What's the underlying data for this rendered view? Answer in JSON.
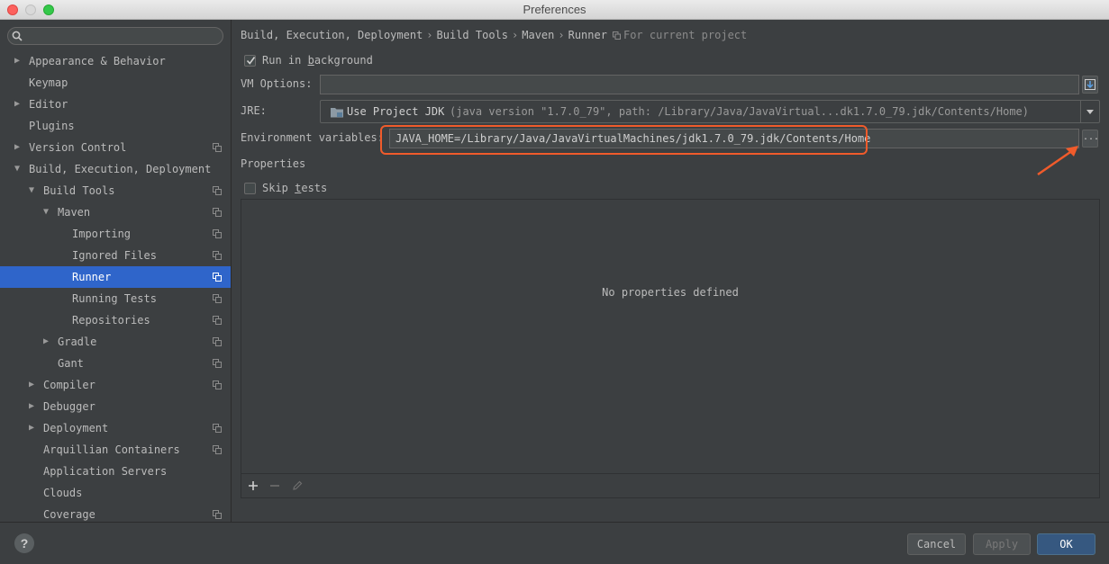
{
  "window": {
    "title": "Preferences"
  },
  "search": {
    "placeholder": ""
  },
  "sidebar": {
    "items": [
      {
        "label": "Appearance & Behavior",
        "indent": 0,
        "arrow": "collapsed",
        "project_icon": false
      },
      {
        "label": "Keymap",
        "indent": 0,
        "arrow": "none",
        "project_icon": false
      },
      {
        "label": "Editor",
        "indent": 0,
        "arrow": "collapsed",
        "project_icon": false
      },
      {
        "label": "Plugins",
        "indent": 0,
        "arrow": "none",
        "project_icon": false
      },
      {
        "label": "Version Control",
        "indent": 0,
        "arrow": "collapsed",
        "project_icon": true
      },
      {
        "label": "Build, Execution, Deployment",
        "indent": 0,
        "arrow": "expanded",
        "project_icon": false
      },
      {
        "label": "Build Tools",
        "indent": 1,
        "arrow": "expanded",
        "project_icon": true
      },
      {
        "label": "Maven",
        "indent": 2,
        "arrow": "expanded",
        "project_icon": true
      },
      {
        "label": "Importing",
        "indent": 3,
        "arrow": "none",
        "project_icon": true
      },
      {
        "label": "Ignored Files",
        "indent": 3,
        "arrow": "none",
        "project_icon": true
      },
      {
        "label": "Runner",
        "indent": 3,
        "arrow": "none",
        "project_icon": true,
        "selected": true
      },
      {
        "label": "Running Tests",
        "indent": 3,
        "arrow": "none",
        "project_icon": true
      },
      {
        "label": "Repositories",
        "indent": 3,
        "arrow": "none",
        "project_icon": true
      },
      {
        "label": "Gradle",
        "indent": 2,
        "arrow": "collapsed",
        "project_icon": true
      },
      {
        "label": "Gant",
        "indent": 2,
        "arrow": "none",
        "project_icon": true
      },
      {
        "label": "Compiler",
        "indent": 1,
        "arrow": "collapsed",
        "project_icon": true
      },
      {
        "label": "Debugger",
        "indent": 1,
        "arrow": "collapsed",
        "project_icon": false
      },
      {
        "label": "Deployment",
        "indent": 1,
        "arrow": "collapsed",
        "project_icon": true
      },
      {
        "label": "Arquillian Containers",
        "indent": 1,
        "arrow": "none",
        "project_icon": true
      },
      {
        "label": "Application Servers",
        "indent": 1,
        "arrow": "none",
        "project_icon": false
      },
      {
        "label": "Clouds",
        "indent": 1,
        "arrow": "none",
        "project_icon": false
      },
      {
        "label": "Coverage",
        "indent": 1,
        "arrow": "none",
        "project_icon": true
      }
    ]
  },
  "breadcrumb": {
    "parts": [
      "Build, Execution, Deployment",
      "Build Tools",
      "Maven",
      "Runner"
    ],
    "separator": "›",
    "scope": "For current project"
  },
  "runner": {
    "run_in_background": {
      "pre": "Run in ",
      "mnemonic": "b",
      "post": "ackground",
      "checked": true
    },
    "vm_options": {
      "label": "VM Options:",
      "value": ""
    },
    "jre": {
      "label": "JRE:",
      "value": "Use Project JDK",
      "detail": "(java version \"1.7.0_79\", path: /Library/Java/JavaVirtual...dk1.7.0_79.jdk/Contents/Home)"
    },
    "env": {
      "label": "Environment variables:",
      "value": "JAVA_HOME=/Library/Java/JavaVirtualMachines/jdk1.7.0_79.jdk/Contents/Home",
      "browse": "..."
    },
    "properties": {
      "title": "Properties",
      "skip_tests": {
        "pre": "Skip ",
        "mnemonic": "t",
        "post": "ests",
        "checked": false
      },
      "empty_text": "No properties defined"
    }
  },
  "footer": {
    "help": "?",
    "cancel": "Cancel",
    "apply": "Apply",
    "ok": "OK"
  },
  "colors": {
    "accent_selection": "#2f65ca",
    "highlight_annotation": "#f05b2b",
    "ok_button": "#365880"
  }
}
